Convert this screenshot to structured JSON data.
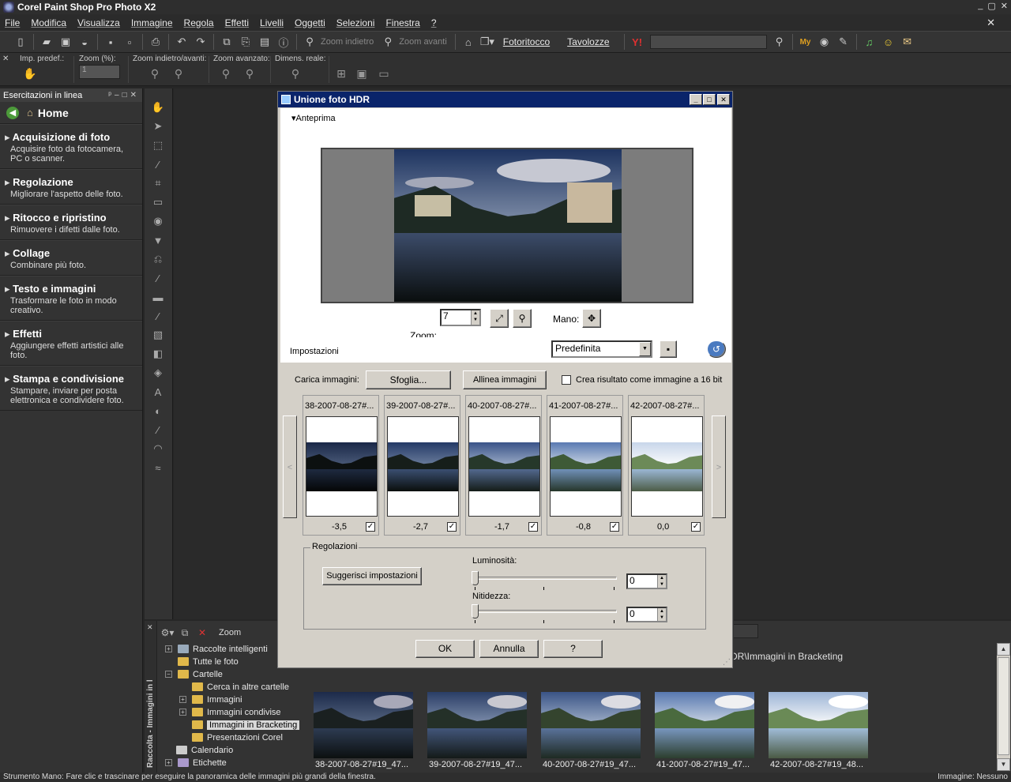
{
  "window": {
    "title": "Corel Paint Shop Pro Photo X2",
    "controls": [
      "_",
      "▢",
      "✕"
    ]
  },
  "menu": [
    "File",
    "Modifica",
    "Visualizza",
    "Immagine",
    "Regola",
    "Effetti",
    "Livelli",
    "Oggetti",
    "Selezioni",
    "Finestra",
    "?"
  ],
  "toolbar": {
    "zoom_in": "Zoom indietro",
    "zoom_out": "Zoom avanti",
    "fotoritocco": "Fotoritocco",
    "tavolozze": "Tavolozze",
    "yahoo": "Y!"
  },
  "options_bar": {
    "imp_predef": "Imp. predef.:",
    "zoom_pct": "Zoom (%):",
    "zoom_value": "1",
    "zoom_inout": "Zoom indietro/avanti:",
    "zoom_adv": "Zoom avanzato:",
    "dimens": "Dimens. reale:"
  },
  "left_panel": {
    "title": "Esercitazioni in linea",
    "home": "Home",
    "items": [
      {
        "title": "Acquisizione di foto",
        "desc": "Acquisire foto da fotocamera, PC o scanner."
      },
      {
        "title": "Regolazione",
        "desc": "Migliorare l'aspetto delle foto."
      },
      {
        "title": "Ritocco e ripristino",
        "desc": "Rimuovere i difetti dalle foto."
      },
      {
        "title": "Collage",
        "desc": "Combinare più foto."
      },
      {
        "title": "Testo e immagini",
        "desc": "Trasformare le foto in modo creativo."
      },
      {
        "title": "Effetti",
        "desc": "Aggiungere effetti artistici alle foto."
      },
      {
        "title": "Stampa e condivisione",
        "desc": "Stampare, inviare per posta elettronica e condividere foto."
      }
    ]
  },
  "dialog": {
    "title": "Unione foto HDR",
    "preview_header": "Anteprima",
    "zoom_label": "Zoom:",
    "zoom_value": "7",
    "mano_label": "Mano:",
    "impostazioni_label": "Impostazioni",
    "preset": "Predefinita",
    "carica_label": "Carica immagini:",
    "sfoglia": "Sfoglia...",
    "allinea": "Allinea immagini",
    "crea_16bit": "Crea risultato come immagine a 16 bit",
    "images": [
      {
        "name": "38-2007-08-27#...",
        "ev": "-3,5",
        "checked": "✓"
      },
      {
        "name": "39-2007-08-27#...",
        "ev": "-2,7",
        "checked": "✓"
      },
      {
        "name": "40-2007-08-27#...",
        "ev": "-1,7",
        "checked": "✓"
      },
      {
        "name": "41-2007-08-27#...",
        "ev": "-0,8",
        "checked": "✓"
      },
      {
        "name": "42-2007-08-27#...",
        "ev": "0,0",
        "checked": "✓"
      }
    ],
    "nav_prev": "<",
    "nav_next": ">",
    "regolazioni": "Regolazioni",
    "suggerisci": "Suggerisci impostazioni",
    "luminosita": "Luminosità:",
    "luminosita_value": "0",
    "nitidezza": "Nitidezza:",
    "nitidezza_value": "0",
    "ok": "OK",
    "annulla": "Annulla",
    "help": "?"
  },
  "organizer": {
    "side_label": "Raccolta - Immagini in l",
    "zoom": "Zoom",
    "path": "DR\\Immagini in Bracketing",
    "tree": [
      {
        "label": "Raccolte intelligenti",
        "pm": "+"
      },
      {
        "label": "Tutte le foto",
        "pm": ""
      },
      {
        "label": "Cartelle",
        "pm": "−"
      },
      {
        "label": "Cerca in altre cartelle",
        "pm": ""
      },
      {
        "label": "Immagini",
        "pm": "+"
      },
      {
        "label": "Immagini condivise",
        "pm": "+"
      },
      {
        "label": "Immagini in Bracketing",
        "pm": ""
      },
      {
        "label": "Presentazioni Corel",
        "pm": ""
      },
      {
        "label": "Calendario",
        "pm": ""
      },
      {
        "label": "Etichette",
        "pm": "+"
      }
    ],
    "thumbnails": [
      "38-2007-08-27#19_47...",
      "39-2007-08-27#19_47...",
      "40-2007-08-27#19_47...",
      "41-2007-08-27#19_47...",
      "42-2007-08-27#19_48..."
    ]
  },
  "status": {
    "left": "Strumento Mano: Fare clic e trascinare per eseguire la panoramica delle immagini più grandi della finestra.",
    "right": "Immagine: Nessuno"
  }
}
